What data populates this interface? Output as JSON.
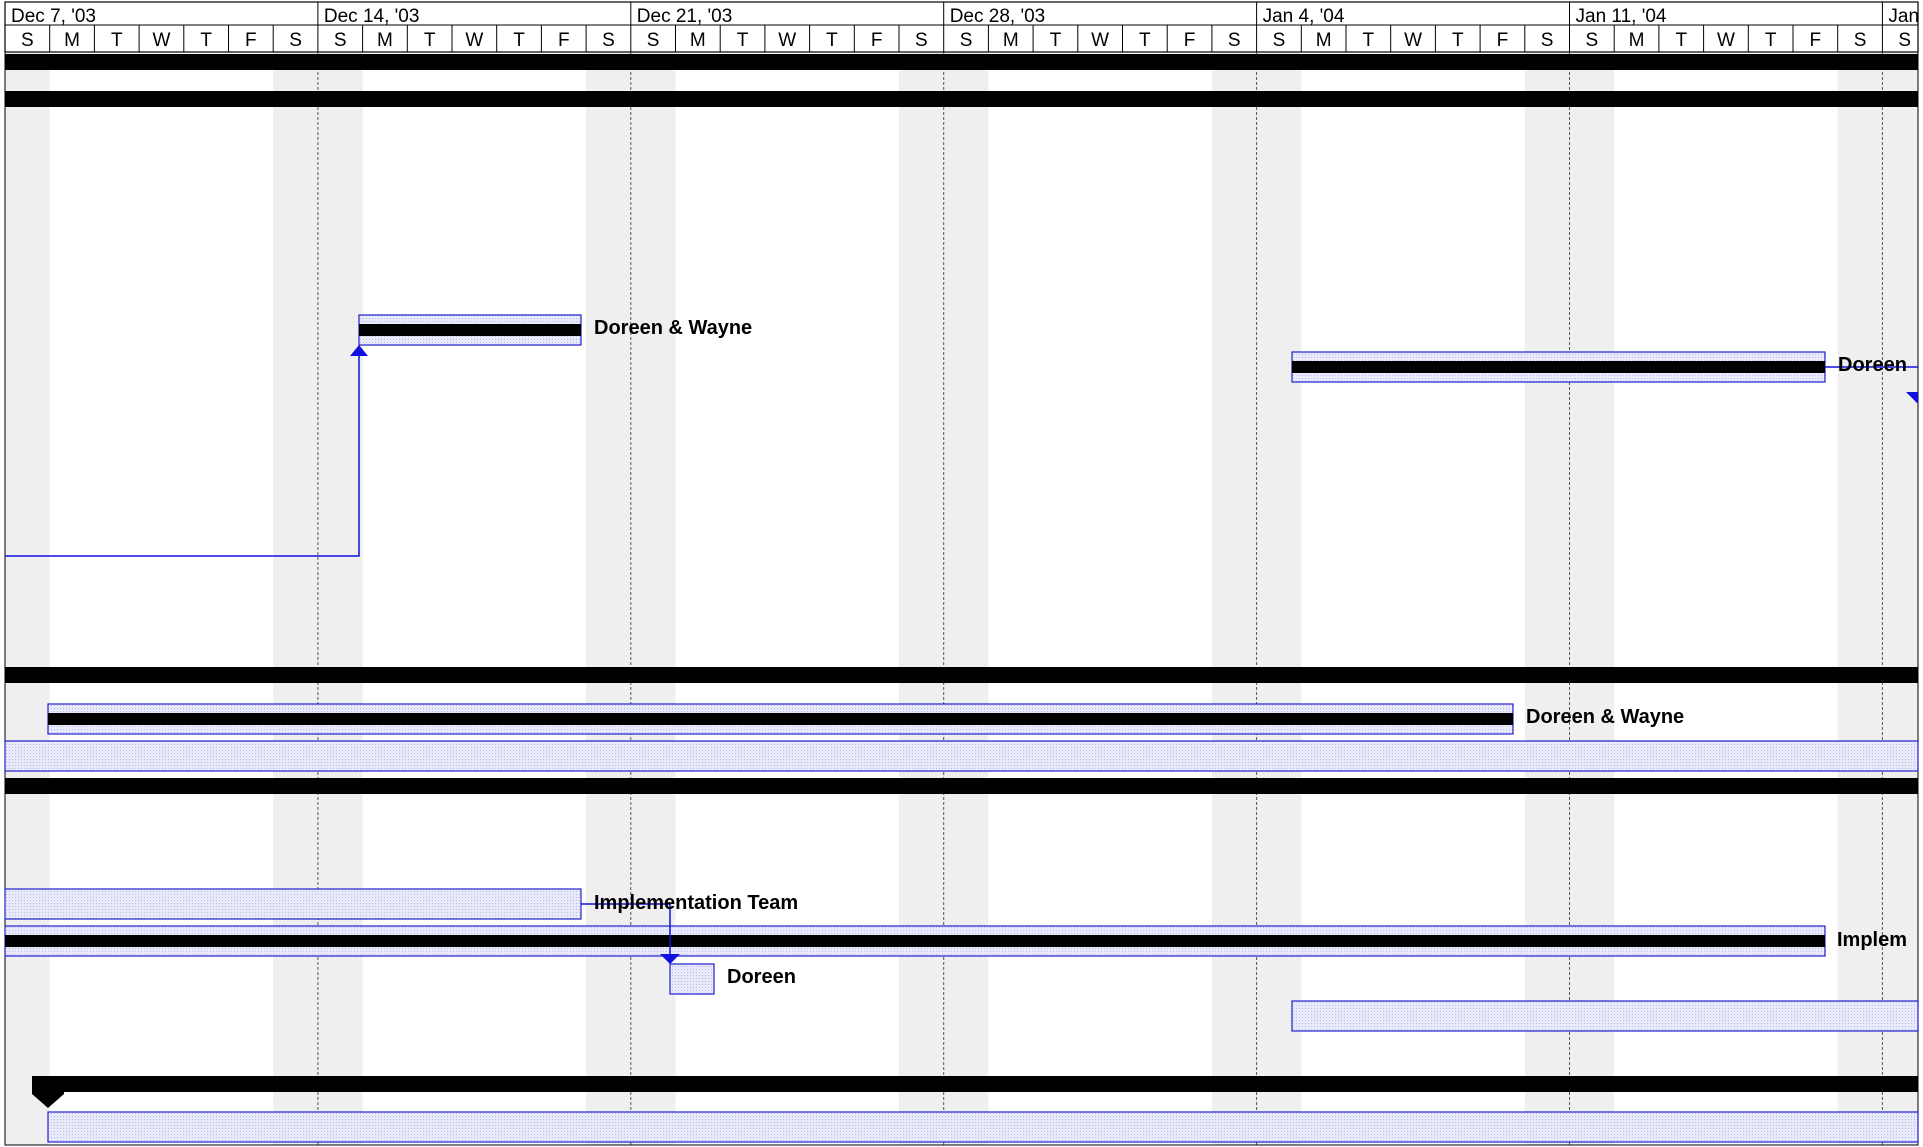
{
  "timescale": {
    "weeks": [
      "Dec 7, '03",
      "Dec 14, '03",
      "Dec 21, '03",
      "Dec 28, '03",
      "Jan 4, '04",
      "Jan 11, '04",
      "Jan"
    ],
    "days": [
      "S",
      "M",
      "T",
      "W",
      "T",
      "F",
      "S"
    ]
  },
  "resources": {
    "doreen_wayne_1": "Doreen & Wayne",
    "doreen_1": "Doreen",
    "doreen_wayne_2": "Doreen & Wayne",
    "implementation_team": "Implementation Team",
    "implem": "Implem",
    "doreen_2": "Doreen"
  },
  "colors": {
    "bar_fill": "#e6e8f8",
    "bar_border": "#2020d0",
    "summary_bar": "#000000",
    "link_line": "#1010e0",
    "nonworking_shade": "#efefef"
  }
}
